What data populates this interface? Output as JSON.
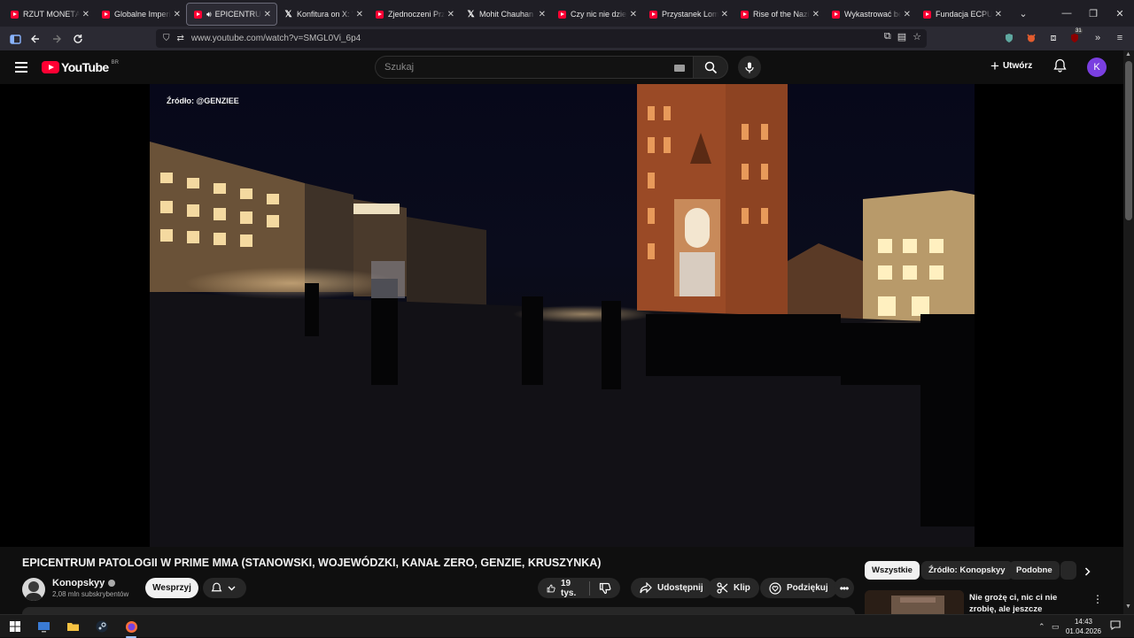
{
  "browser": {
    "tabs": [
      {
        "title": "RZUT MONETĄ DE",
        "icon": "youtube-icon",
        "active": false
      },
      {
        "title": "Globalne Imperiu",
        "icon": "youtube-icon",
        "active": false
      },
      {
        "title": "EPICENTRUM",
        "icon": "youtube-icon",
        "active": true,
        "audio": true
      },
      {
        "title": "Konfitura on X: \"P",
        "icon": "x-icon",
        "active": false
      },
      {
        "title": "Zjednoczeni Przec",
        "icon": "youtube-icon",
        "active": false
      },
      {
        "title": "Mohit Chauhan on",
        "icon": "x-icon",
        "active": false
      },
      {
        "title": "Czy nic nie dzieje",
        "icon": "youtube-icon",
        "active": false
      },
      {
        "title": "Przystanek Lomba",
        "icon": "youtube-icon",
        "active": false
      },
      {
        "title": "Rise of the Nazis a",
        "icon": "youtube-icon",
        "active": false
      },
      {
        "title": "Wykastrować bez",
        "icon": "youtube-icon",
        "active": false
      },
      {
        "title": "Fundacja ECPU Po",
        "icon": "youtube-icon",
        "active": false
      }
    ],
    "url": "www.youtube.com/watch?v=SMGL0Vi_6p4",
    "extension_badge": "31"
  },
  "youtube": {
    "logo_text": "YouTube",
    "country_code": "BR",
    "search_placeholder": "Szukaj",
    "create_label": "Utwórz",
    "avatar_letter": "K",
    "avatar_color": "#7a3fe0"
  },
  "video": {
    "source_watermark": "Źródło: @GENZIEE",
    "title": "EPICENTRUM PATOLOGII W PRIME MMA (STANOWSKI, WOJEWÓDZKI, KANAŁ ZERO, GENZIE, KRUSZYNKA)",
    "channel_name": "Konopskyy",
    "subscribers": "2,08 mln subskrybentów",
    "support_label": "Wesprzyj",
    "likes": "19 tys.",
    "share_label": "Udostępnij",
    "clip_label": "Klip",
    "thanks_label": "Podziękuj"
  },
  "sidebar": {
    "chips": [
      "Wszystkie",
      "Źródło: Konopskyy",
      "Podobne"
    ],
    "active_chip": "Wszystkie",
    "recommendations": [
      {
        "title": "Nie grożę ci, nic ci nie zrobię, ale jeszcze zobaczysz w ..."
      }
    ]
  },
  "taskbar": {
    "time": "14:43",
    "date": "01.04.2026"
  }
}
